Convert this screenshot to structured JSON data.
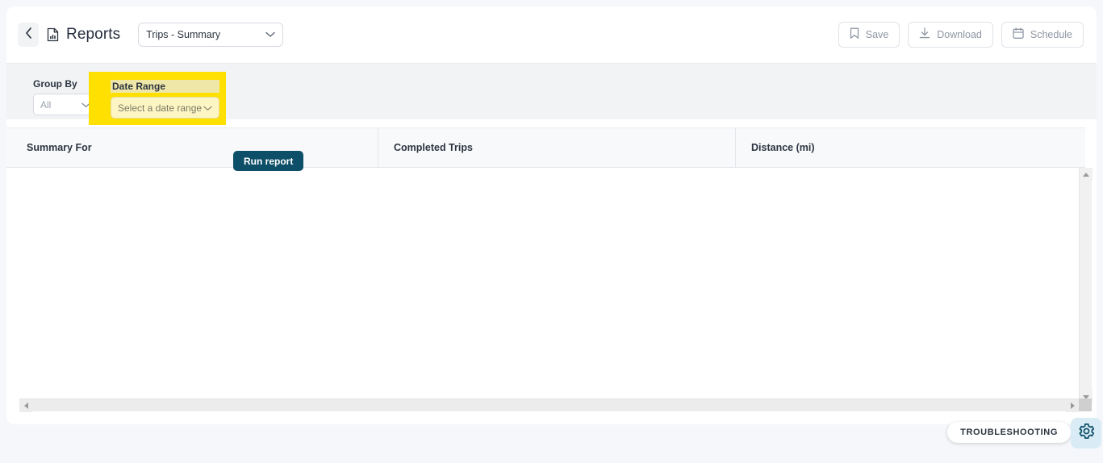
{
  "header": {
    "back_icon": "chevron-left-icon",
    "report_icon": "report-document-icon",
    "title": "Reports",
    "report_select": {
      "value": "Trips - Summary",
      "chevron": "chevron-down-icon"
    },
    "actions": [
      {
        "label": "Save",
        "icon": "bookmark-icon"
      },
      {
        "label": "Download",
        "icon": "download-icon"
      },
      {
        "label": "Schedule",
        "icon": "calendar-icon"
      }
    ]
  },
  "filters": {
    "group_by": {
      "label": "Group By",
      "value": "All",
      "chevron": "chevron-down-icon"
    },
    "date_range": {
      "label": "Date Range",
      "placeholder": "Select a date range",
      "chevron": "chevron-down-icon",
      "highlighted": true
    },
    "run_button": "Run report"
  },
  "table": {
    "columns": [
      "Summary For",
      "Completed Trips",
      "Distance (mi)"
    ],
    "rows": []
  },
  "footer": {
    "troubleshooting_label": "TROUBLESHOOTING",
    "gear_icon": "gear-icon"
  },
  "colors": {
    "page_background": "#f5f7fa",
    "highlight": "#ffe000",
    "primary_button": "#0d4f68",
    "gear_button_background": "#d9ecf5"
  }
}
